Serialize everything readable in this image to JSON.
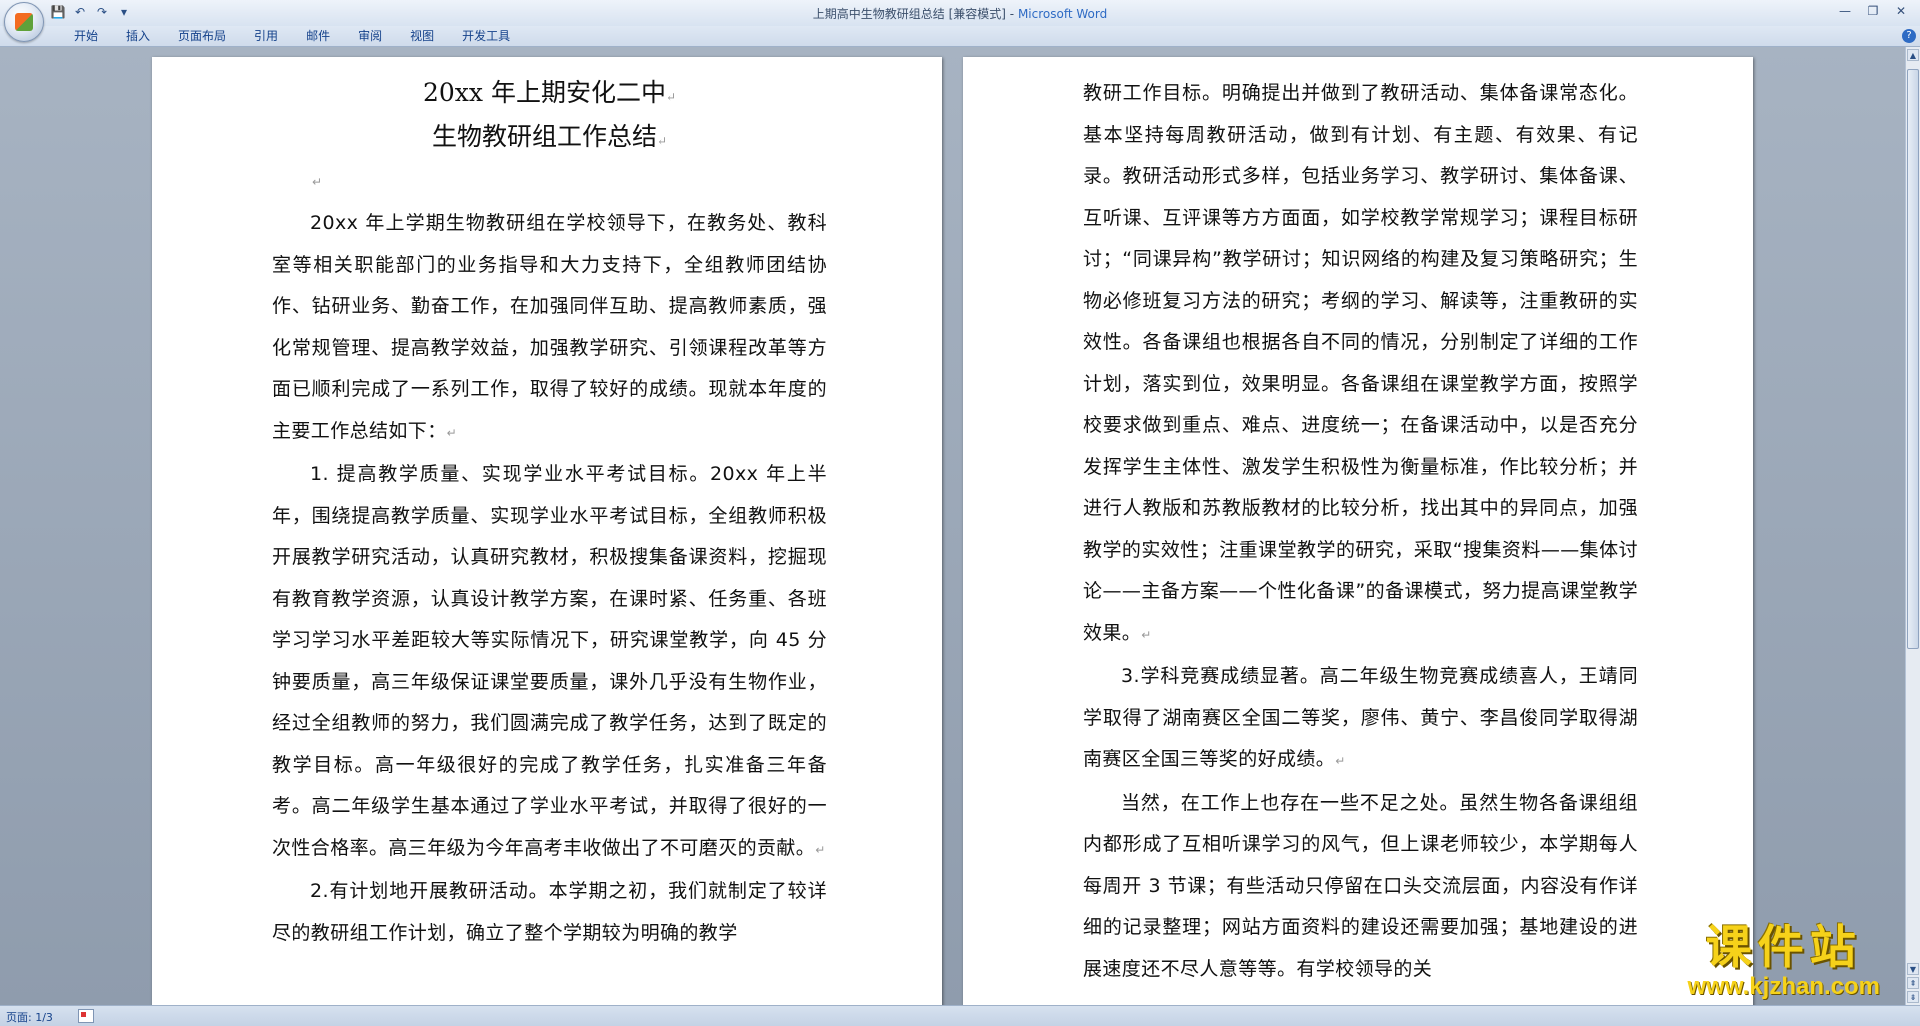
{
  "window": {
    "doc_title": "上期高中生物教研组总结 [兼容模式] -",
    "app_name": "Microsoft Word"
  },
  "ribbon": {
    "tabs": [
      "开始",
      "插入",
      "页面布局",
      "引用",
      "邮件",
      "审阅",
      "视图",
      "开发工具"
    ]
  },
  "document": {
    "title_line1": "20xx 年上期安化二中",
    "title_line2": "生物教研组工作总结",
    "left_page": [
      "20xx 年上学期生物教研组在学校领导下，在教务处、教科室等相关职能部门的业务指导和大力支持下，全组教师团结协作、钻研业务、勤奋工作，在加强同伴互助、提高教师素质，强化常规管理、提高教学效益，加强教学研究、引领课程改革等方面已顺利完成了一系列工作，取得了较好的成绩。现就本年度的主要工作总结如下：",
      "1.  提高教学质量、实现学业水平考试目标。20xx 年上半年，围绕提高教学质量、实现学业水平考试目标，全组教师积极开展教学研究活动，认真研究教材，积极搜集备课资料，挖掘现有教育教学资源，认真设计教学方案，在课时紧、任务重、各班学习学习水平差距较大等实际情况下，研究课堂教学，向 45 分钟要质量，高三年级保证课堂要质量，课外几乎没有生物作业，经过全组教师的努力，我们圆满完成了教学任务，达到了既定的教学目标。高一年级很好的完成了教学任务，扎实准备三年备考。高二年级学生基本通过了学业水平考试，并取得了很好的一次性合格率。高三年级为今年高考丰收做出了不可磨灭的贡献。",
      "2.有计划地开展教研活动。本学期之初，我们就制定了较详尽的教研组工作计划，确立了整个学期较为明确的教学"
    ],
    "right_page": [
      "教研工作目标。明确提出并做到了教研活动、集体备课常态化。基本坚持每周教研活动，做到有计划、有主题、有效果、有记录。教研活动形式多样，包括业务学习、教学研讨、集体备课、互听课、互评课等方方面面，如学校教学常规学习；课程目标研讨；“同课异构”教学研讨；知识网络的构建及复习策略研究；生物必修班复习方法的研究；考纲的学习、解读等，注重教研的实效性。各备课组也根据各自不同的情况，分别制定了详细的工作计划，落实到位，效果明显。各备课组在课堂教学方面，按照学校要求做到重点、难点、进度统一；在备课活动中，以是否充分发挥学生主体性、激发学生积极性为衡量标准，作比较分析；并进行人教版和苏教版教材的比较分析，找出其中的异同点，加强教学的实效性；注重课堂教学的研究，采取“搜集资料——集体讨论——主备方案——个性化备课”的备课模式，努力提高课堂教学效果。",
      "3.学科竞赛成绩显著。高二年级生物竞赛成绩喜人，王靖同学取得了湖南赛区全国二等奖，廖伟、黄宁、李昌俊同学取得湖南赛区全国三等奖的好成绩。",
      "当然，在工作上也存在一些不足之处。虽然生物各备课组组内都形成了互相听课学习的风气，但上课老师较少，本学期每人每周开 3 节课；有些活动只停留在口头交流层面，内容没有作详细的记录整理；网站方面资料的建设还需要加强；基地建设的进展速度还不尽人意等等。有学校领导的关"
    ],
    "paragraph_mark": "↵"
  },
  "status": {
    "page_indicator": "页面: 1/3"
  },
  "watermark": {
    "text": "课件站",
    "url": "www.kjzhan.com"
  },
  "colors": {
    "accent": "#2e6bc4",
    "workspace_bg": "#9aa7b6",
    "watermark": "#f6d21a"
  }
}
